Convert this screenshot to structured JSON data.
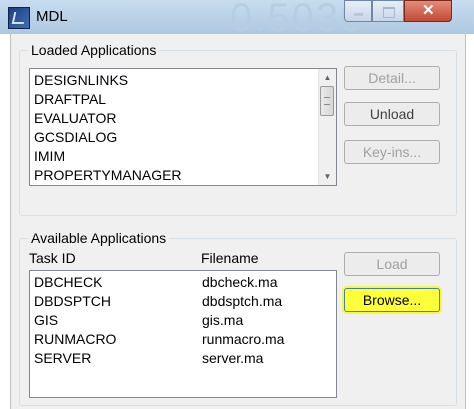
{
  "window": {
    "title": "MDL",
    "ghost_text": "0.5030"
  },
  "loaded_applications": {
    "legend": "Loaded Applications",
    "items": [
      "DESIGNLINKS",
      "DRAFTPAL",
      "EVALUATOR",
      "GCSDIALOG",
      "IMIM",
      "PROPERTYMANAGER"
    ]
  },
  "buttons": {
    "detail": "Detail...",
    "unload": "Unload",
    "keyins": "Key-ins...",
    "load": "Load",
    "browse": "Browse..."
  },
  "available_applications": {
    "legend": "Available Applications",
    "columns": {
      "task_id": "Task ID",
      "filename": "Filename"
    },
    "rows": [
      {
        "task_id": "DBCHECK",
        "filename": "dbcheck.ma"
      },
      {
        "task_id": "DBDSPTCH",
        "filename": "dbdsptch.ma"
      },
      {
        "task_id": "GIS",
        "filename": "gis.ma"
      },
      {
        "task_id": "RUNMACRO",
        "filename": "runmacro.ma"
      },
      {
        "task_id": "SERVER",
        "filename": "server.ma"
      }
    ]
  },
  "colors": {
    "browse_highlight": "#ffff3a",
    "titlebar": "#c8dcee",
    "close_button": "#c34a32"
  }
}
